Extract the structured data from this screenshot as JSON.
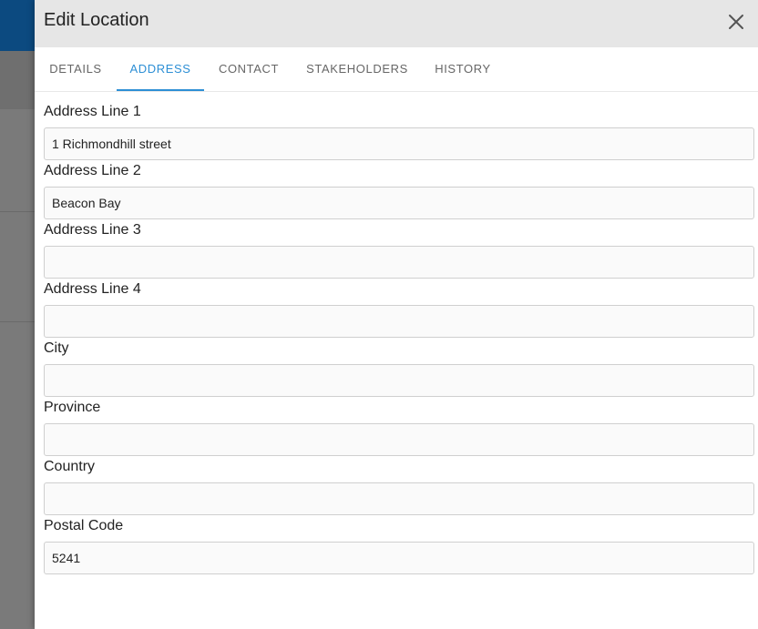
{
  "dialog": {
    "title": "Edit Location",
    "close_icon": "close-icon"
  },
  "tabs": [
    {
      "label": "DETAILS",
      "active": false
    },
    {
      "label": "ADDRESS",
      "active": true
    },
    {
      "label": "CONTACT",
      "active": false
    },
    {
      "label": "STAKEHOLDERS",
      "active": false
    },
    {
      "label": "HISTORY",
      "active": false
    }
  ],
  "fields": {
    "address_line_1": {
      "label": "Address Line 1",
      "value": "1 Richmondhill street"
    },
    "address_line_2": {
      "label": "Address Line 2",
      "value": "Beacon Bay"
    },
    "address_line_3": {
      "label": "Address Line 3",
      "value": ""
    },
    "address_line_4": {
      "label": "Address Line 4",
      "value": ""
    },
    "city": {
      "label": "City",
      "value": ""
    },
    "province": {
      "label": "Province",
      "value": ""
    },
    "country": {
      "label": "Country",
      "value": ""
    },
    "postal_code": {
      "label": "Postal Code",
      "value": "5241"
    }
  },
  "colors": {
    "accent": "#2d8fd5",
    "header_bg": "#e6e6e6",
    "backdrop": "#7a7a7a",
    "app_bar": "#0c4a80"
  }
}
